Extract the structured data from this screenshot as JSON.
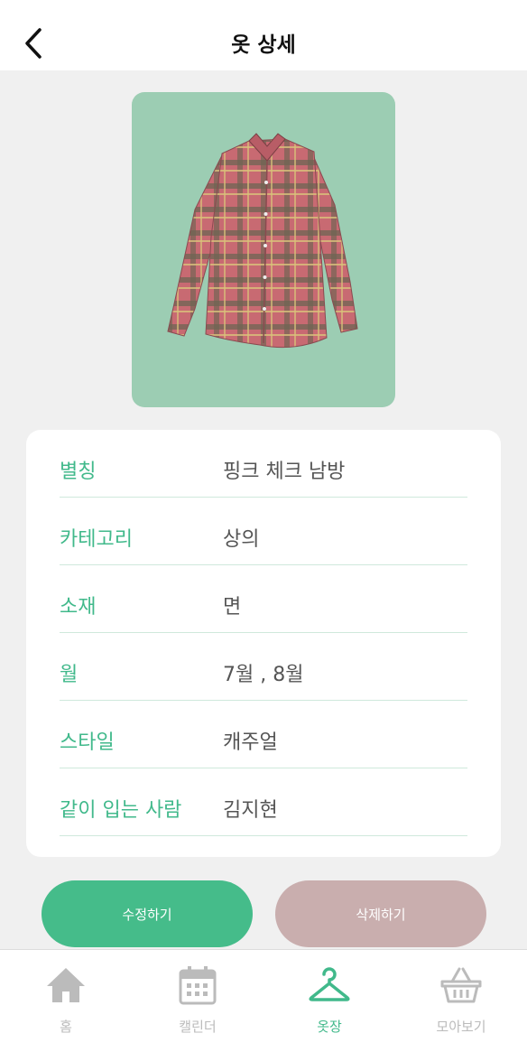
{
  "header": {
    "title": "옷 상세",
    "back_icon": "chevron-left-icon"
  },
  "clothing": {
    "image": "plaid-shirt-photo",
    "fields": [
      {
        "label": "별칭",
        "value": "핑크 체크 남방"
      },
      {
        "label": "카테고리",
        "value": "상의"
      },
      {
        "label": "소재",
        "value": "면"
      },
      {
        "label": "월",
        "value": "7월 , 8월"
      },
      {
        "label": "스타일",
        "value": "캐주얼"
      },
      {
        "label": "같이 입는 사람",
        "value": "김지현"
      }
    ]
  },
  "actions": {
    "edit_label": "수정하기",
    "delete_label": "삭제하기"
  },
  "tabbar": {
    "items": [
      {
        "label": "홈",
        "icon": "home-icon",
        "active": false
      },
      {
        "label": "캘린더",
        "icon": "calendar-icon",
        "active": false
      },
      {
        "label": "옷장",
        "icon": "hanger-icon",
        "active": true
      },
      {
        "label": "모아보기",
        "icon": "basket-icon",
        "active": false
      }
    ]
  },
  "colors": {
    "accent": "#41b98b",
    "edit_button": "#45bc8a",
    "delete_button": "#c9aeae",
    "photo_background": "#9ccdb3",
    "page_background": "#f0f0f0",
    "inactive_tab": "#bbbbbb"
  }
}
